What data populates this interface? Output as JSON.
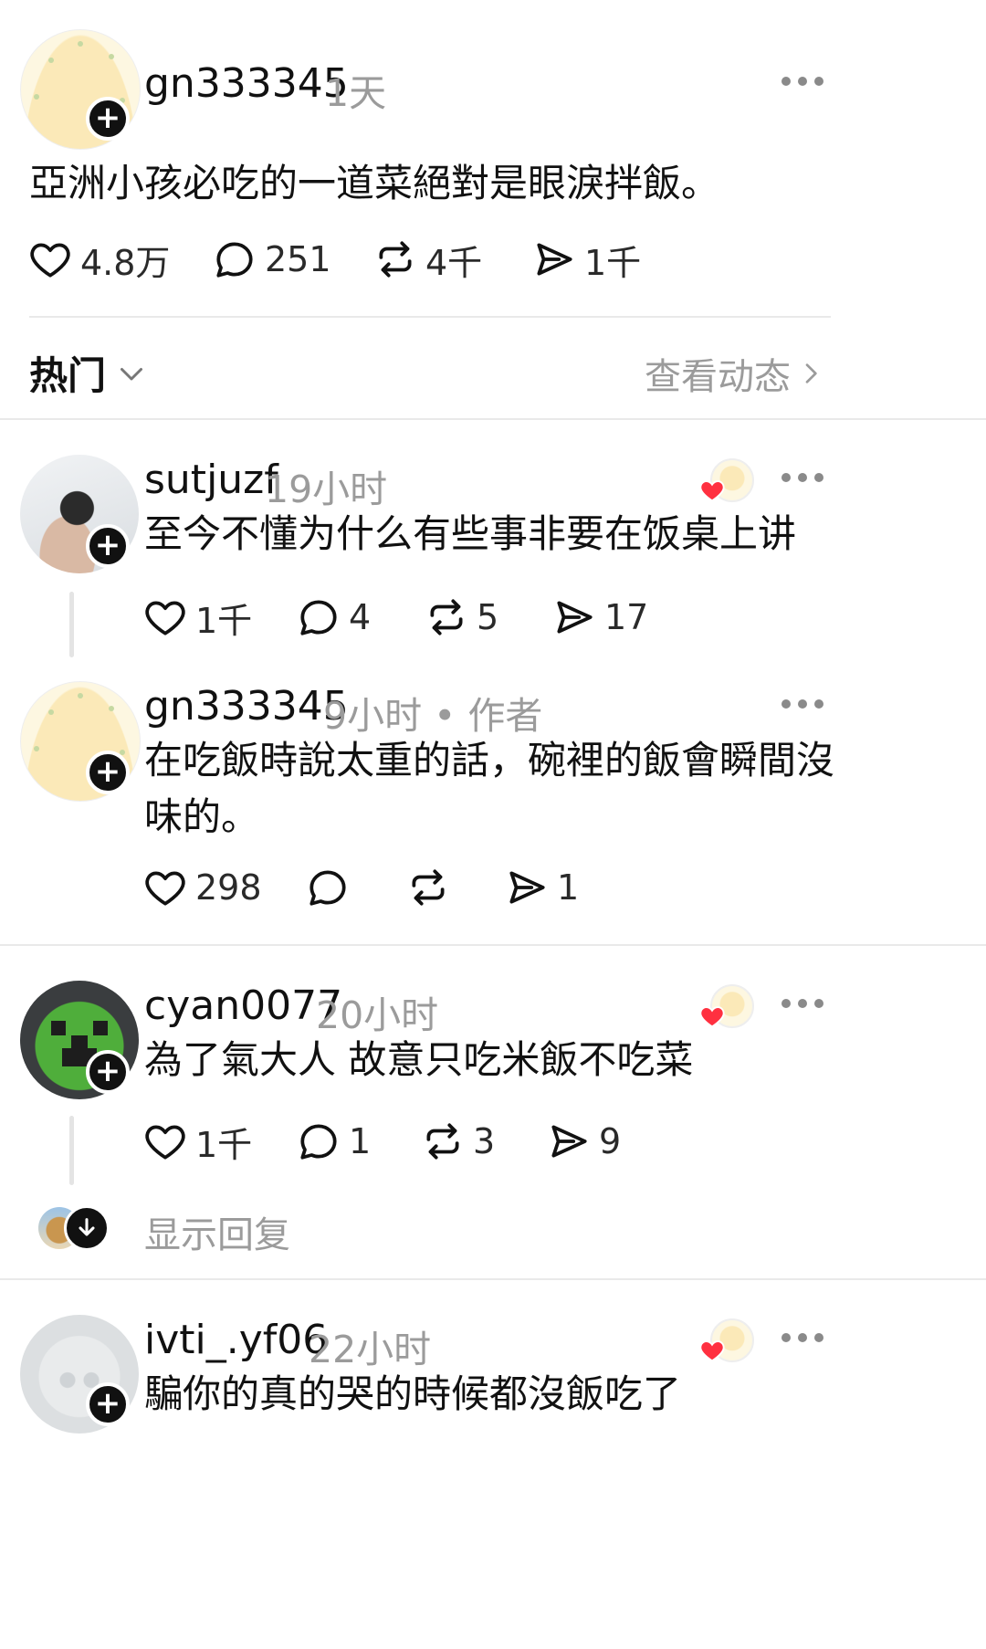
{
  "post": {
    "username": "gn333345",
    "time": "1天",
    "text": "亞洲小孩必吃的一道菜絕對是眼淚拌飯。",
    "likes": "4.8万",
    "comments": "251",
    "reposts": "4千",
    "shares": "1千"
  },
  "sort": {
    "label": "热门",
    "view_activity": "查看动态"
  },
  "replies": [
    {
      "username": "sutjuzf",
      "time": "19小时",
      "text": "至今不懂为什么有些事非要在饭桌上讲",
      "likes": "1千",
      "comments": "4",
      "reposts": "5",
      "shares": "17"
    },
    {
      "username": "gn333345",
      "time": "9小时 • 作者",
      "text": "在吃飯時說太重的話，碗裡的飯會瞬間沒味的。",
      "likes": "298",
      "comments": "",
      "reposts": "",
      "shares": "1"
    },
    {
      "username": "cyan0077",
      "time": "20小时",
      "text": "為了氣大人 故意只吃米飯不吃菜",
      "likes": "1千",
      "comments": "1",
      "reposts": "3",
      "shares": "9",
      "show_replies": "显示回复"
    },
    {
      "username": "ivti_.yf06",
      "time": "22小时",
      "text": "騙你的真的哭的時候都沒飯吃了"
    }
  ],
  "colors": {
    "text_primary": "#111111",
    "text_secondary": "#9b9b9b",
    "heart_red": "#ff3040",
    "divider": "#e9e9e9"
  }
}
